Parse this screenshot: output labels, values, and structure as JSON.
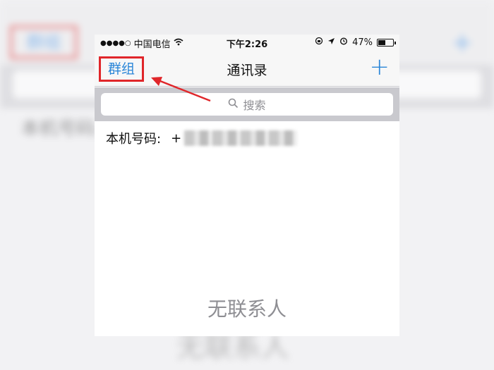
{
  "status_bar": {
    "signal_dots": "●●●●○",
    "carrier": "中国电信",
    "time": "下午2:26",
    "battery": "47%"
  },
  "nav": {
    "groups_label": "群组",
    "title": "通讯录",
    "add_label": "+"
  },
  "search": {
    "placeholder": "搜索"
  },
  "my_number": {
    "label": "本机号码:",
    "prefix": "+"
  },
  "empty_state": "无联系人",
  "colors": {
    "accent": "#2a86d8",
    "highlight": "#e0262a"
  }
}
